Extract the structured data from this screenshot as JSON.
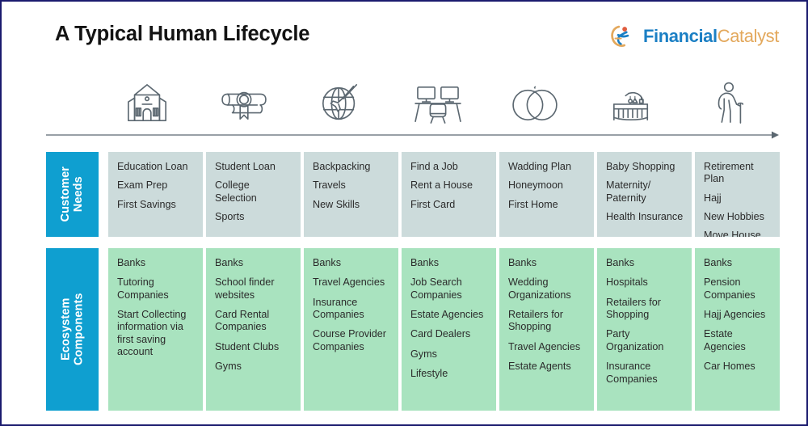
{
  "header": {
    "title": "A Typical Human Lifecycle",
    "brand_primary": "Financial",
    "brand_secondary": "Catalyst",
    "brand_primary_color": "#1b7fc4",
    "brand_secondary_color": "#e3a85c",
    "logo_icon": "running-figure-icon"
  },
  "colors": {
    "accent_blue": "#0f9fd0",
    "needs_cell": "#ccdbdb",
    "ecosystem_cell": "#a9e3bf",
    "frame_border": "#1a1a6e",
    "icon_stroke": "#5b6770",
    "arrow": "#5b6770"
  },
  "timeline": {
    "arrow_name": "lifecycle-timeline-arrow",
    "stages": [
      {
        "icon": "school-building-icon",
        "label": "school"
      },
      {
        "icon": "diploma-certificate-icon",
        "label": "graduation"
      },
      {
        "icon": "globe-airplane-icon",
        "label": "travel"
      },
      {
        "icon": "desk-monitors-chair-icon",
        "label": "work"
      },
      {
        "icon": "wedding-rings-icon",
        "label": "marriage"
      },
      {
        "icon": "baby-crib-icon",
        "label": "parenthood"
      },
      {
        "icon": "elderly-person-cane-icon",
        "label": "retirement"
      }
    ]
  },
  "bands": [
    {
      "id": "customer-needs",
      "label_line1": "Customer",
      "label_line2": "Needs",
      "columns": [
        {
          "items": [
            "Education Loan",
            "Exam Prep",
            "First Savings"
          ]
        },
        {
          "items": [
            "Student Loan",
            "College Selection",
            "Sports"
          ]
        },
        {
          "items": [
            "Backpacking",
            "Travels",
            "New Skills"
          ]
        },
        {
          "items": [
            "Find a Job",
            "Rent a House",
            "First Card"
          ]
        },
        {
          "items": [
            "Wadding Plan",
            "Honeymoon",
            "First Home"
          ]
        },
        {
          "items": [
            "Baby Shopping",
            "Maternity/ Paternity",
            "Health Insurance"
          ]
        },
        {
          "items": [
            "Retirement Plan",
            "Hajj",
            "New Hobbies",
            "Move House"
          ]
        }
      ]
    },
    {
      "id": "ecosystem-components",
      "label_line1": "Ecosystem",
      "label_line2": "Components",
      "columns": [
        {
          "items": [
            "Banks",
            "Tutoring Companies",
            "Start Collecting information via first saving account"
          ]
        },
        {
          "items": [
            "Banks",
            "School finder websites",
            "Card Rental Companies",
            "Student Clubs",
            "Gyms"
          ]
        },
        {
          "items": [
            "Banks",
            "Travel Agencies",
            "Insurance Companies",
            "Course Provider Companies"
          ]
        },
        {
          "items": [
            "Banks",
            "Job Search Companies",
            "Estate Agencies",
            "Card Dealers",
            "Gyms",
            "Lifestyle"
          ]
        },
        {
          "items": [
            "Banks",
            "Wedding Organizations",
            "Retailers for Shopping",
            "Travel Agencies",
            "Estate Agents"
          ]
        },
        {
          "items": [
            "Banks",
            "Hospitals",
            "Retailers for Shopping",
            "Party Organization",
            "Insurance Companies"
          ]
        },
        {
          "items": [
            "Banks",
            "Pension Companies",
            "Hajj Agencies",
            "Estate Agencies",
            "Car Homes"
          ]
        }
      ]
    }
  ]
}
